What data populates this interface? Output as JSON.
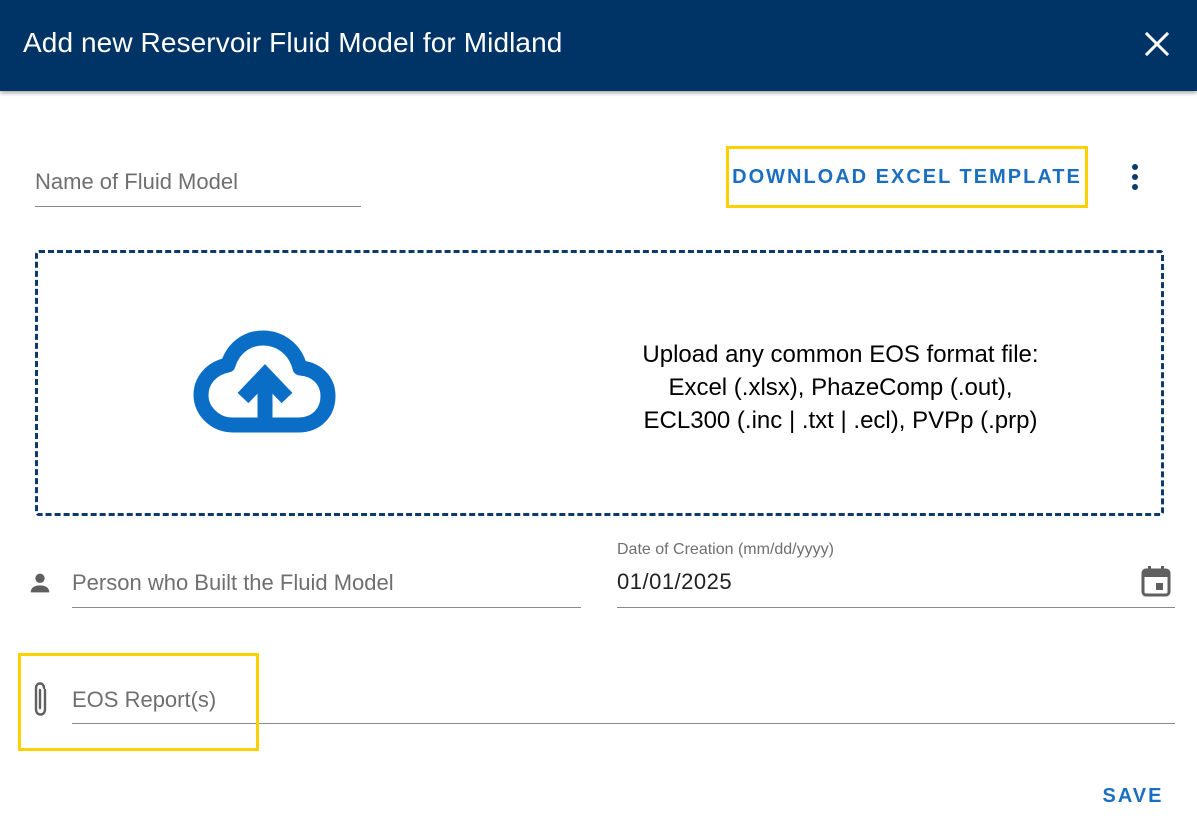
{
  "dialog": {
    "title": "Add new Reservoir Fluid Model for Midland",
    "close_icon": "close-icon"
  },
  "form": {
    "name_placeholder": "Name of Fluid Model",
    "download_template_label": "DOWNLOAD EXCEL TEMPLATE",
    "more_icon": "more-vert-icon",
    "upload": {
      "icon": "cloud-upload-icon",
      "line1": "Upload any common EOS format file:",
      "line2": "Excel (.xlsx), PhazeComp (.out),",
      "line3": "ECL300 (.inc | .txt | .ecl), PVPp (.prp)"
    },
    "person_icon": "person-icon",
    "person_placeholder": "Person who Built the Fluid Model",
    "date_label": "Date of Creation (mm/dd/yyyy)",
    "date_value": "01/01/2025",
    "calendar_icon": "calendar-icon",
    "attach_icon": "paperclip-icon",
    "eos_placeholder": "EOS Report(s)",
    "save_label": "SAVE"
  },
  "colors": {
    "header_bg": "#003366",
    "accent": "#1a6fc0",
    "highlight": "#ffd000",
    "upload_icon": "#0a6ec7"
  }
}
